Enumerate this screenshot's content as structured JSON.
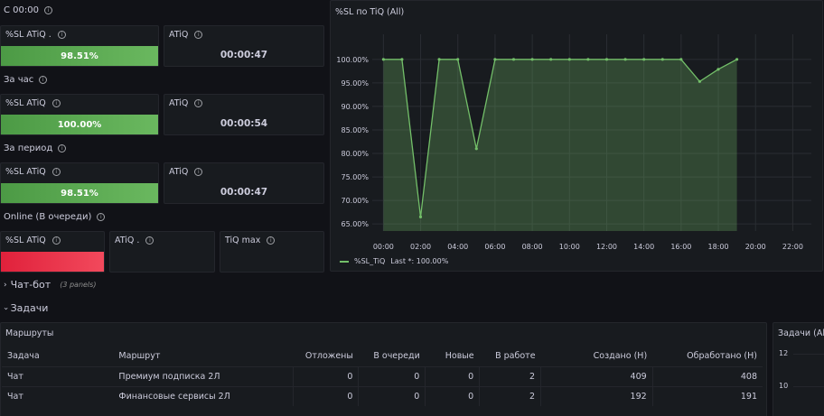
{
  "rows": {
    "since_midnight": {
      "title": "С 00:00"
    },
    "last_hour": {
      "title": "За час"
    },
    "period": {
      "title": "За период"
    },
    "online": {
      "title": "Online (В очереди)"
    }
  },
  "stats": {
    "since_midnight": {
      "sl": {
        "title": "%SL ATiQ .",
        "value": "98.51%",
        "percent": 98.51
      },
      "atiq": {
        "title": "ATiQ",
        "value": "00:00:47"
      }
    },
    "last_hour": {
      "sl": {
        "title": "%SL ATiQ",
        "value": "100.00%",
        "percent": 100.0
      },
      "atiq": {
        "title": "ATiQ",
        "value": "00:00:54"
      }
    },
    "period": {
      "sl": {
        "title": "%SL ATiQ",
        "value": "98.51%",
        "percent": 98.51
      },
      "atiq": {
        "title": "ATiQ",
        "value": "00:00:47"
      }
    },
    "online": {
      "sl": {
        "title": "%SL ATiQ",
        "status_color": "#e0213b"
      },
      "atiq": {
        "title": "ATiQ ."
      },
      "tiq_max": {
        "title": "TiQ max"
      }
    }
  },
  "timeseries_panel": {
    "title": "%SL по TiQ (All)",
    "legend": {
      "series": "%SL_TiQ",
      "last": "Last *: 100.00%"
    }
  },
  "chart_data": {
    "type": "area",
    "title": "%SL по TiQ (All)",
    "xlabel": "",
    "ylabel": "",
    "ylim": [
      63.5,
      101.5
    ],
    "y_ticks": [
      "100.00%",
      "95.00%",
      "90.00%",
      "85.00%",
      "80.00%",
      "75.00%",
      "70.00%",
      "65.00%"
    ],
    "y_tick_values": [
      100,
      95,
      90,
      85,
      80,
      75,
      70,
      65
    ],
    "x_ticks": [
      "00:00",
      "02:00",
      "04:00",
      "06:00",
      "08:00",
      "10:00",
      "12:00",
      "14:00",
      "16:00",
      "18:00",
      "20:00",
      "22:00"
    ],
    "x_tick_hours": [
      0,
      2,
      4,
      6,
      8,
      10,
      12,
      14,
      16,
      18,
      20,
      22
    ],
    "xlim_hours": [
      -0.6,
      23.0
    ],
    "grid": true,
    "legend": "bottom-left",
    "series": [
      {
        "name": "%SL_TiQ",
        "color": "#73bf69",
        "x_hours": [
          0,
          1,
          2,
          3,
          4,
          5,
          6,
          7,
          8,
          9,
          10,
          11,
          12,
          13,
          14,
          15,
          16,
          17,
          18,
          19
        ],
        "values": [
          100,
          100,
          66.5,
          100,
          100,
          81,
          100,
          100,
          100,
          100,
          100,
          100,
          100,
          100,
          100,
          100,
          100,
          95.3,
          97.9,
          100
        ]
      }
    ]
  },
  "sections": {
    "chatbot": {
      "title": "Чат-бот",
      "count": "(3 panels)"
    },
    "tasks": {
      "title": "Задачи"
    }
  },
  "routes_panel": {
    "title": "Маршруты",
    "columns": [
      "Задача",
      "Маршрут",
      "Отложены",
      "В очереди",
      "Новые",
      "В работе",
      "Создано (Н)",
      "Обработано (Н)"
    ],
    "rows": [
      [
        "Чат",
        "Премиум подписка 2Л",
        "0",
        "0",
        "0",
        "2",
        "409",
        "408"
      ],
      [
        "Чат",
        "Финансовые сервисы 2Л",
        "0",
        "0",
        "0",
        "2",
        "192",
        "191"
      ]
    ]
  },
  "tasks_panel": {
    "title": "Задачи (All)",
    "y_ticks": [
      "12",
      "10"
    ]
  },
  "colors": {
    "background": "#111217",
    "panel": "#181b1f",
    "green": "#73bf69",
    "red": "#f2495c"
  }
}
